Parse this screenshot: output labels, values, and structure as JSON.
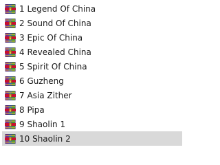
{
  "file_list": {
    "icon": "rar-archive-icon",
    "selected_index": 9,
    "items": [
      {
        "name": "1 Legend Of China"
      },
      {
        "name": "2 Sound Of China"
      },
      {
        "name": "3 Epic Of China"
      },
      {
        "name": "4 Revealed China"
      },
      {
        "name": "5 Spirit Of China"
      },
      {
        "name": "6 Guzheng"
      },
      {
        "name": "7 Asia Zither"
      },
      {
        "name": "8 Pipa"
      },
      {
        "name": "9 Shaolin 1"
      },
      {
        "name": "10 Shaolin 2"
      }
    ]
  }
}
